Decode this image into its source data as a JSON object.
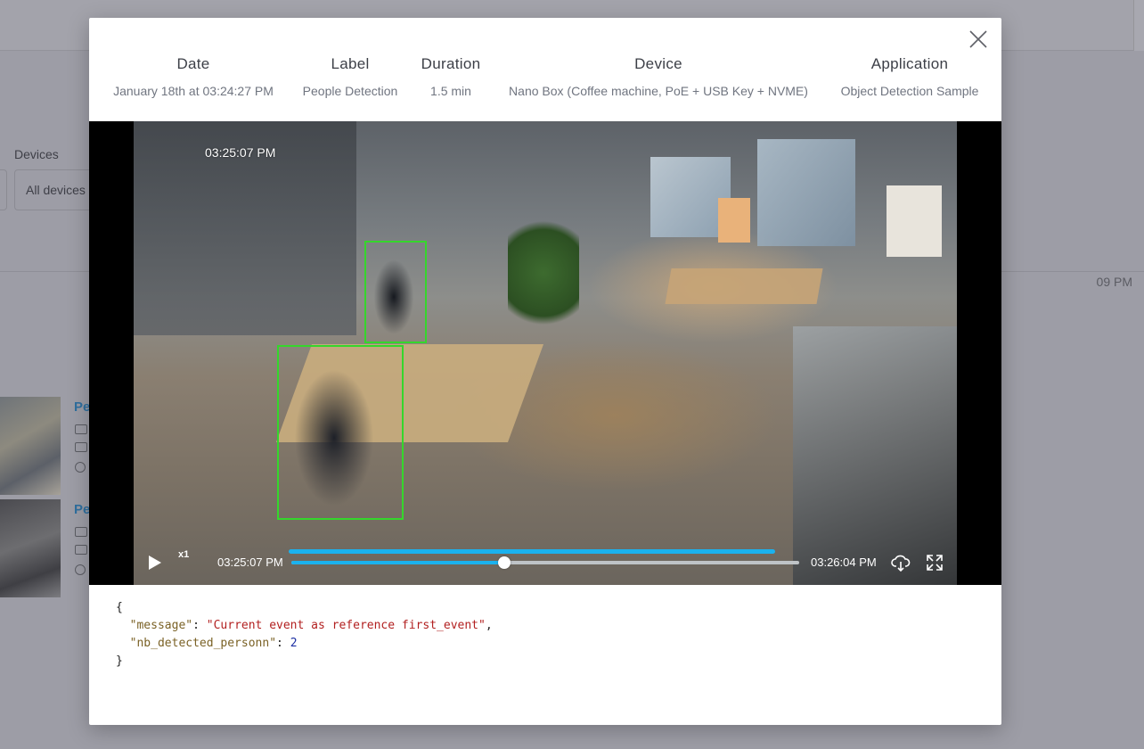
{
  "background": {
    "devices_label": "Devices",
    "devices_select_value": "All devices",
    "timeline_time": "09 PM",
    "event_title_1": "Pe",
    "event_title_2": "Pe"
  },
  "modal": {
    "close_icon": "close-icon",
    "meta": [
      {
        "heading": "Date",
        "value": "January 18th at 03:24:27 PM"
      },
      {
        "heading": "Label",
        "value": "People Detection"
      },
      {
        "heading": "Duration",
        "value": "1.5 min"
      },
      {
        "heading": "Device",
        "value": "Nano Box (Coffee machine, PoE + USB Key + NVME)"
      },
      {
        "heading": "Application",
        "value": "Object Detection Sample"
      }
    ],
    "video": {
      "overlay_timestamp": "03:25:07 PM",
      "detections": 2,
      "player": {
        "play_icon": "play-icon",
        "speed": "x1",
        "current_time": "03:25:07 PM",
        "end_time": "03:26:04 PM",
        "progress": 0.42,
        "download_icon": "cloud-download-icon",
        "fullscreen_icon": "fullscreen-icon"
      }
    },
    "json_output": {
      "open": "{",
      "close": "}",
      "entries": [
        {
          "key": "\"message\"",
          "value": "\"Current event as reference first_event\"",
          "trail": ","
        },
        {
          "key": "\"nb_detected_personn\"",
          "value": "2",
          "trail": ""
        }
      ]
    }
  },
  "colors": {
    "accent": "#1bb2ee",
    "bbox": "#35d62c",
    "overlay": "#9d9da6"
  }
}
